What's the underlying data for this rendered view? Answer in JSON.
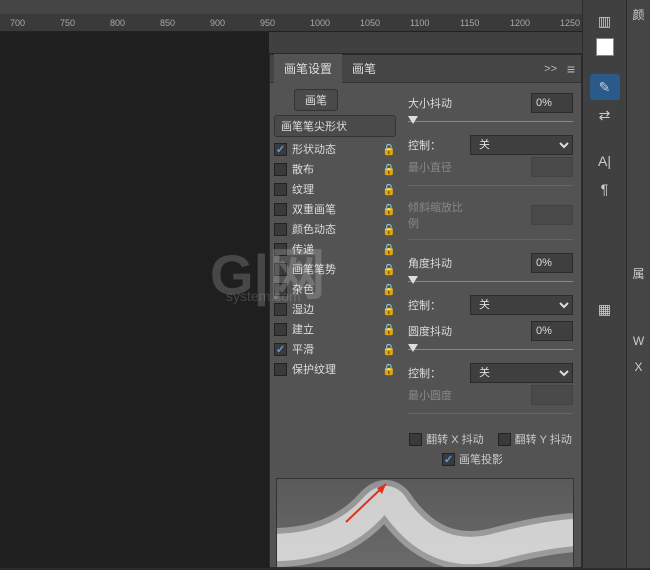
{
  "ruler": {
    "ticks": [
      "700",
      "750",
      "800",
      "850",
      "900",
      "950",
      "1000",
      "1050",
      "1100",
      "1150",
      "1200",
      "1250"
    ]
  },
  "panel": {
    "tabs": {
      "settings": "画笔设置",
      "brushes": "画笔"
    },
    "collapse": ">>",
    "brush_button": "画笔",
    "shape_header": "画笔笔尖形状",
    "options": [
      {
        "label": "形状动态",
        "checked": true
      },
      {
        "label": "散布",
        "checked": false
      },
      {
        "label": "纹理",
        "checked": false
      },
      {
        "label": "双重画笔",
        "checked": false
      },
      {
        "label": "颜色动态",
        "checked": false
      },
      {
        "label": "传递",
        "checked": false
      },
      {
        "label": "画笔笔势",
        "checked": false
      },
      {
        "label": "杂色",
        "checked": false
      },
      {
        "label": "湿边",
        "checked": false
      },
      {
        "label": "建立",
        "checked": false
      },
      {
        "label": "平滑",
        "checked": true
      },
      {
        "label": "保护纹理",
        "checked": false
      }
    ],
    "controls": {
      "size_jitter": "大小抖动",
      "size_jitter_val": "0%",
      "control": "控制：",
      "control_off": "关",
      "min_diameter": "最小直径",
      "tilt_scale": "倾斜缩放比例",
      "angle_jitter": "角度抖动",
      "angle_jitter_val": "0%",
      "round_jitter": "圆度抖动",
      "round_jitter_val": "0%",
      "min_round": "最小圆度",
      "flip_x": "翻转 X 抖动",
      "flip_y": "翻转 Y 抖动",
      "brush_proj": "画笔投影"
    }
  },
  "far": {
    "c1": "颜",
    "c2": "属",
    "w": "W",
    "x": "X"
  },
  "watermark": {
    "main": "G|网",
    "sub": "system.com"
  }
}
